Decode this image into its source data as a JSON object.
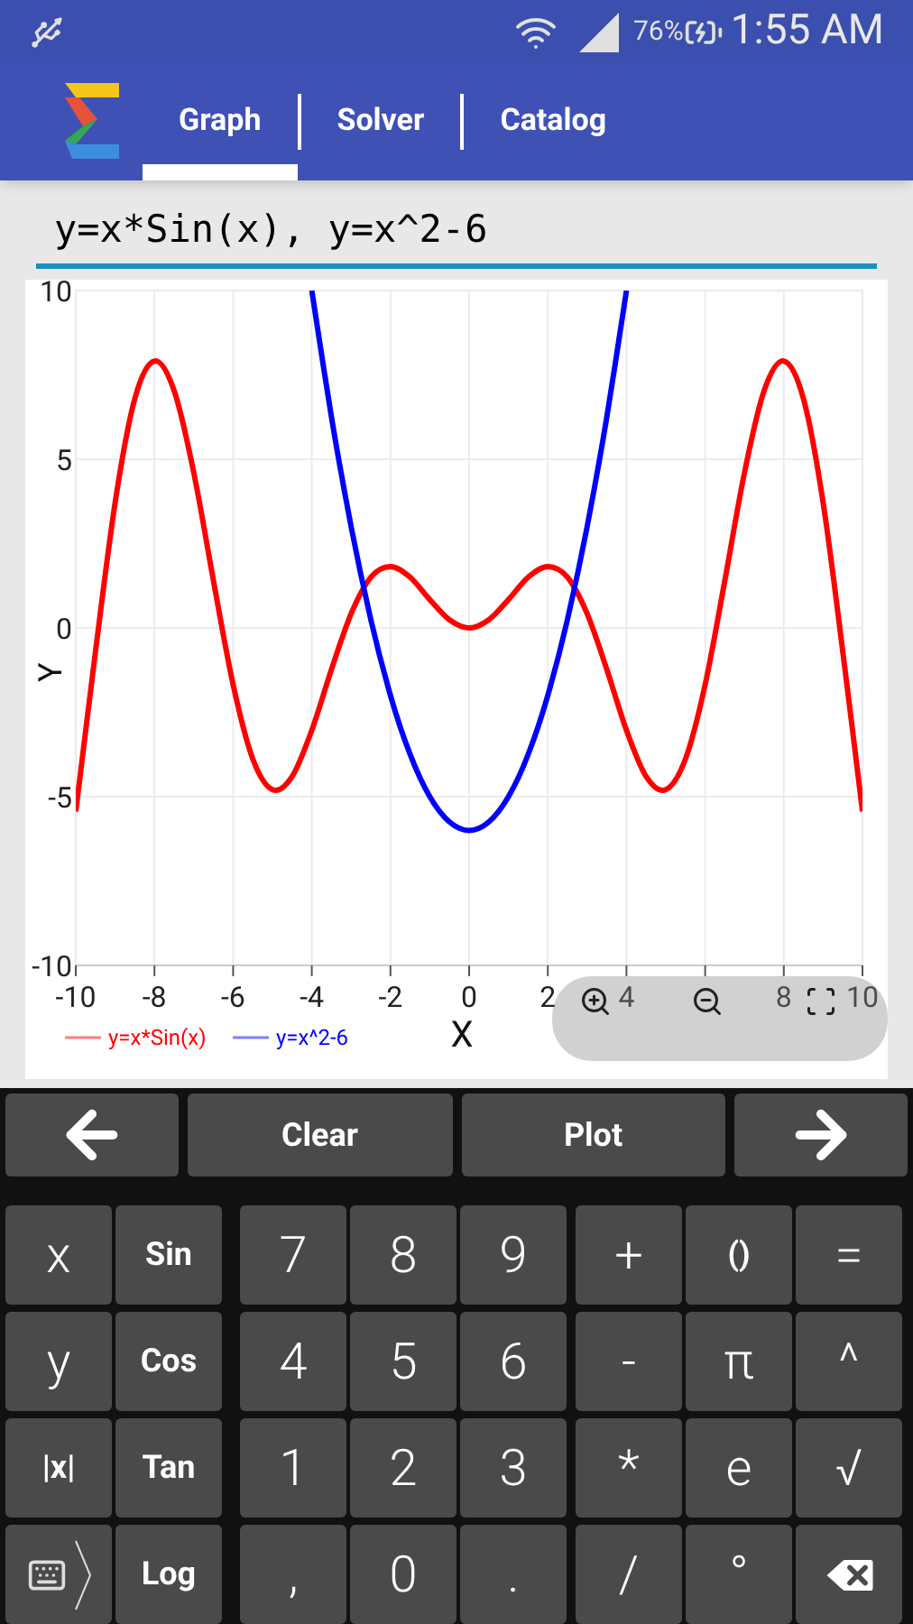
{
  "status_bar": {
    "battery": "76%",
    "time": "1:55 AM"
  },
  "tabs": [
    {
      "label": "Graph",
      "selected": true
    },
    {
      "label": "Solver",
      "selected": false
    },
    {
      "label": "Catalog",
      "selected": false
    }
  ],
  "expression": {
    "value": "y=x*Sin(x), y=x^2-6"
  },
  "chart_data": {
    "type": "line",
    "xlabel": "X",
    "ylabel": "Y",
    "x": [
      -10,
      -9.5,
      -9,
      -8.5,
      -8,
      -7.5,
      -7,
      -6.5,
      -6,
      -5.5,
      -5,
      -4.5,
      -4,
      -3.5,
      -3,
      -2.5,
      -2,
      -1.5,
      -1,
      -0.5,
      0,
      0.5,
      1,
      1.5,
      2,
      2.5,
      3,
      3.5,
      4,
      4.5,
      5,
      5.5,
      6,
      6.5,
      7,
      7.5,
      8,
      8.5,
      9,
      9.5,
      10
    ],
    "series": [
      {
        "name": "y=x*Sin(x)",
        "color": "#ff0000",
        "values": [
          -5.44,
          -0.71,
          3.71,
          6.79,
          7.91,
          7.03,
          4.6,
          1.4,
          -1.68,
          -3.88,
          -4.79,
          -4.4,
          -3.03,
          -1.23,
          0.42,
          1.5,
          1.82,
          1.5,
          0.84,
          0.24,
          0,
          0.24,
          0.84,
          1.5,
          1.82,
          1.5,
          0.42,
          -1.23,
          -3.03,
          -4.4,
          -4.79,
          -3.88,
          -1.68,
          1.4,
          4.6,
          7.03,
          7.91,
          6.79,
          3.71,
          -0.71,
          -5.44
        ]
      },
      {
        "name": "y=x^2-6",
        "color": "#0000ff",
        "values": [
          null,
          null,
          null,
          null,
          null,
          null,
          null,
          null,
          null,
          null,
          null,
          null,
          10,
          6.25,
          3,
          0.25,
          -2,
          -3.75,
          -5,
          -5.75,
          -6,
          -5.75,
          -5,
          -3.75,
          -2,
          0.25,
          3,
          6.25,
          10,
          null,
          null,
          null,
          null,
          null,
          null,
          null,
          null,
          null,
          null,
          null,
          null
        ]
      }
    ],
    "xlim": [
      -10,
      10
    ],
    "ylim": [
      -10,
      10
    ],
    "xticks": [
      -10,
      -8,
      -6,
      -4,
      -2,
      0,
      2,
      4,
      8,
      10
    ],
    "yticks": [
      -10,
      -5,
      0,
      5,
      10
    ],
    "grid": true,
    "legend": "bottom-left"
  },
  "keypad": {
    "top_row": [
      {
        "kind": "left-arrow"
      },
      {
        "kind": "text",
        "label": "Clear"
      },
      {
        "kind": "text",
        "label": "Plot"
      },
      {
        "kind": "right-arrow"
      }
    ],
    "rows": [
      [
        {
          "kind": "big",
          "label": "x"
        },
        {
          "kind": "fn",
          "label": "Sin"
        },
        {
          "kind": "big",
          "label": "7"
        },
        {
          "kind": "big",
          "label": "8"
        },
        {
          "kind": "big",
          "label": "9"
        },
        {
          "kind": "big",
          "label": "+"
        },
        {
          "kind": "fn",
          "label": "()"
        },
        {
          "kind": "big",
          "label": "="
        }
      ],
      [
        {
          "kind": "big",
          "label": "y"
        },
        {
          "kind": "fn",
          "label": "Cos"
        },
        {
          "kind": "big",
          "label": "4"
        },
        {
          "kind": "big",
          "label": "5"
        },
        {
          "kind": "big",
          "label": "6"
        },
        {
          "kind": "big",
          "label": "-"
        },
        {
          "kind": "big",
          "label": "π"
        },
        {
          "kind": "big",
          "label": "^"
        }
      ],
      [
        {
          "kind": "fn",
          "label": "|x|"
        },
        {
          "kind": "fn",
          "label": "Tan"
        },
        {
          "kind": "big",
          "label": "1"
        },
        {
          "kind": "big",
          "label": "2"
        },
        {
          "kind": "big",
          "label": "3"
        },
        {
          "kind": "big",
          "label": "*"
        },
        {
          "kind": "big",
          "label": "e"
        },
        {
          "kind": "big",
          "label": "√"
        }
      ],
      [
        {
          "kind": "keyboard"
        },
        {
          "kind": "fn",
          "label": "Log"
        },
        {
          "kind": "big",
          "label": ","
        },
        {
          "kind": "big",
          "label": "0"
        },
        {
          "kind": "big",
          "label": "."
        },
        {
          "kind": "big",
          "label": "/"
        },
        {
          "kind": "big",
          "label": "°"
        },
        {
          "kind": "backspace"
        }
      ]
    ]
  }
}
